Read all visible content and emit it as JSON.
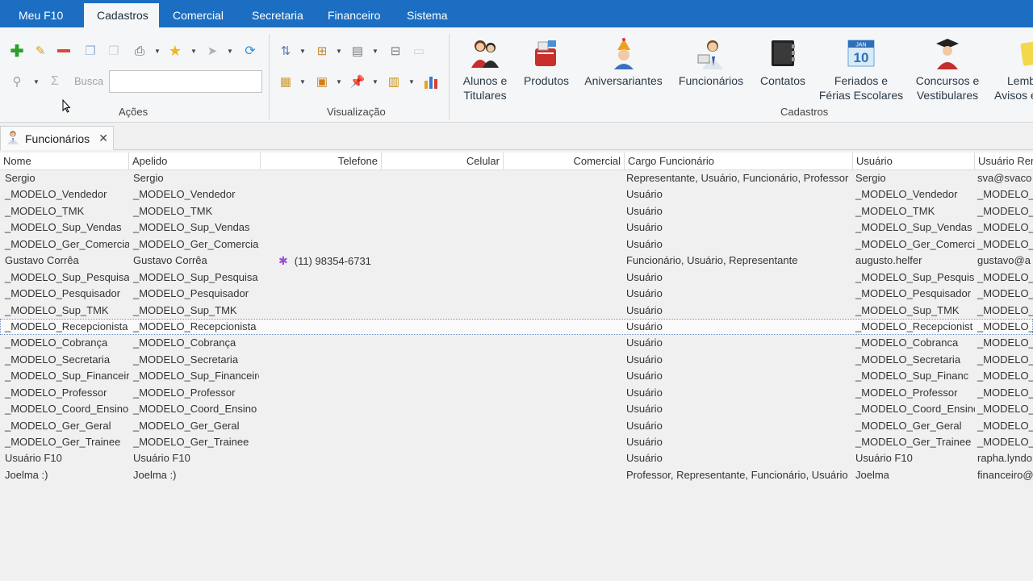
{
  "menu": {
    "tabs": [
      {
        "label": "Meu F10",
        "active": false
      },
      {
        "label": "Cadastros",
        "active": true
      },
      {
        "label": "Comercial",
        "active": false
      },
      {
        "label": "Secretaria",
        "active": false
      },
      {
        "label": "Financeiro",
        "active": false
      },
      {
        "label": "Sistema",
        "active": false
      }
    ]
  },
  "ribbon": {
    "groups": {
      "acoes": "Ações",
      "visualizacao": "Visualização",
      "cadastros": "Cadastros"
    },
    "search": {
      "label": "Busca",
      "value": "",
      "placeholder": ""
    },
    "big_buttons": [
      {
        "line1": "Alunos e",
        "line2": "Titulares"
      },
      {
        "line1": "Produtos",
        "line2": ""
      },
      {
        "line1": "Aniversariantes",
        "line2": ""
      },
      {
        "line1": "Funcionários",
        "line2": ""
      },
      {
        "line1": "Contatos",
        "line2": ""
      },
      {
        "line1": "Feriados e",
        "line2": "Férias Escolares"
      },
      {
        "line1": "Concursos e",
        "line2": "Vestibulares"
      },
      {
        "line1": "Lemb",
        "line2": "Avisos e"
      }
    ],
    "calendar_icon_text": "JAN",
    "calendar_icon_day": "10"
  },
  "doc_tab": {
    "label": "Funcionários",
    "close": "✕"
  },
  "colors": {
    "menubar": "#1b6ec2",
    "accent_icon": "#9b4dd9"
  },
  "grid": {
    "columns": [
      "Nome",
      "Apelido",
      "Telefone",
      "Celular",
      "Comercial",
      "Cargo Funcionário",
      "Usuário",
      "Usuário Rem"
    ],
    "rows": [
      {
        "nome": "Sergio",
        "apelido": "Sergio",
        "telefone": "",
        "cargo": "Representante, Usuário, Funcionário, Professor",
        "usuario": "Sergio",
        "usuario_rem": "sva@svaco"
      },
      {
        "nome": "_MODELO_Vendedor",
        "apelido": "_MODELO_Vendedor",
        "telefone": "",
        "cargo": "Usuário",
        "usuario": "_MODELO_Vendedor",
        "usuario_rem": "_MODELO_V"
      },
      {
        "nome": "_MODELO_TMK",
        "apelido": "_MODELO_TMK",
        "telefone": "",
        "cargo": "Usuário",
        "usuario": "_MODELO_TMK",
        "usuario_rem": "_MODELO_T"
      },
      {
        "nome": "_MODELO_Sup_Vendas",
        "apelido": "_MODELO_Sup_Vendas",
        "telefone": "",
        "cargo": "Usuário",
        "usuario": "_MODELO_Sup_Vendas",
        "usuario_rem": "_MODELO_S"
      },
      {
        "nome": "_MODELO_Ger_Comercial",
        "apelido": "_MODELO_Ger_Comercial",
        "telefone": "",
        "cargo": "Usuário",
        "usuario": "_MODELO_Ger_Comercia",
        "usuario_rem": "_MODELO_G"
      },
      {
        "nome": "Gustavo Corrêa",
        "apelido": "Gustavo Corrêa",
        "telefone": "(11) 98354-6731",
        "cargo": "Funcionário, Usuário, Representante",
        "usuario": "augusto.helfer",
        "usuario_rem": "gustavo@a"
      },
      {
        "nome": "_MODELO_Sup_Pesquisa",
        "apelido": "_MODELO_Sup_Pesquisa",
        "telefone": "",
        "cargo": "Usuário",
        "usuario": "_MODELO_Sup_Pesquisa",
        "usuario_rem": "_MODELO_S"
      },
      {
        "nome": "_MODELO_Pesquisador",
        "apelido": "_MODELO_Pesquisador",
        "telefone": "",
        "cargo": "Usuário",
        "usuario": "_MODELO_Pesquisador",
        "usuario_rem": "_MODELO_F"
      },
      {
        "nome": "_MODELO_Sup_TMK",
        "apelido": "_MODELO_Sup_TMK",
        "telefone": "",
        "cargo": "Usuário",
        "usuario": "_MODELO_Sup_TMK",
        "usuario_rem": "_MODELO_S"
      },
      {
        "nome": "_MODELO_Recepcionista",
        "apelido": "_MODELO_Recepcionista",
        "telefone": "",
        "cargo": "Usuário",
        "usuario": "_MODELO_Recepcionist",
        "usuario_rem": "_MODELO_F",
        "selected": true
      },
      {
        "nome": "_MODELO_Cobrança",
        "apelido": "_MODELO_Cobrança",
        "telefone": "",
        "cargo": "Usuário",
        "usuario": "_MODELO_Cobranca",
        "usuario_rem": "_MODELO_C"
      },
      {
        "nome": "_MODELO_Secretaria",
        "apelido": "_MODELO_Secretaria",
        "telefone": "",
        "cargo": "Usuário",
        "usuario": "_MODELO_Secretaria",
        "usuario_rem": "_MODELO_S"
      },
      {
        "nome": "_MODELO_Sup_Financeiro",
        "apelido": "_MODELO_Sup_Financeiro",
        "telefone": "",
        "cargo": "Usuário",
        "usuario": "_MODELO_Sup_Financ",
        "usuario_rem": "_MODELO_S"
      },
      {
        "nome": "_MODELO_Professor",
        "apelido": "_MODELO_Professor",
        "telefone": "",
        "cargo": "Usuário",
        "usuario": "_MODELO_Professor",
        "usuario_rem": "_MODELO_F"
      },
      {
        "nome": "_MODELO_Coord_Ensino",
        "apelido": "_MODELO_Coord_Ensino",
        "telefone": "",
        "cargo": "Usuário",
        "usuario": "_MODELO_Coord_Ensino",
        "usuario_rem": "_MODELO_C"
      },
      {
        "nome": "_MODELO_Ger_Geral",
        "apelido": "_MODELO_Ger_Geral",
        "telefone": "",
        "cargo": "Usuário",
        "usuario": "_MODELO_Ger_Geral",
        "usuario_rem": "_MODELO_G"
      },
      {
        "nome": "_MODELO_Ger_Trainee",
        "apelido": "_MODELO_Ger_Trainee",
        "telefone": "",
        "cargo": "Usuário",
        "usuario": "_MODELO_Ger_Trainee",
        "usuario_rem": "_MODELO_G"
      },
      {
        "nome": "Usuário F10",
        "apelido": "Usuário F10",
        "telefone": "",
        "cargo": "Usuário",
        "usuario": "Usuário F10",
        "usuario_rem": "rapha.lyndo"
      },
      {
        "nome": "Joelma :)",
        "apelido": "Joelma :)",
        "telefone": "",
        "cargo": "Professor, Representante, Funcionário, Usuário",
        "usuario": "Joelma",
        "usuario_rem": "financeiro@"
      }
    ]
  }
}
